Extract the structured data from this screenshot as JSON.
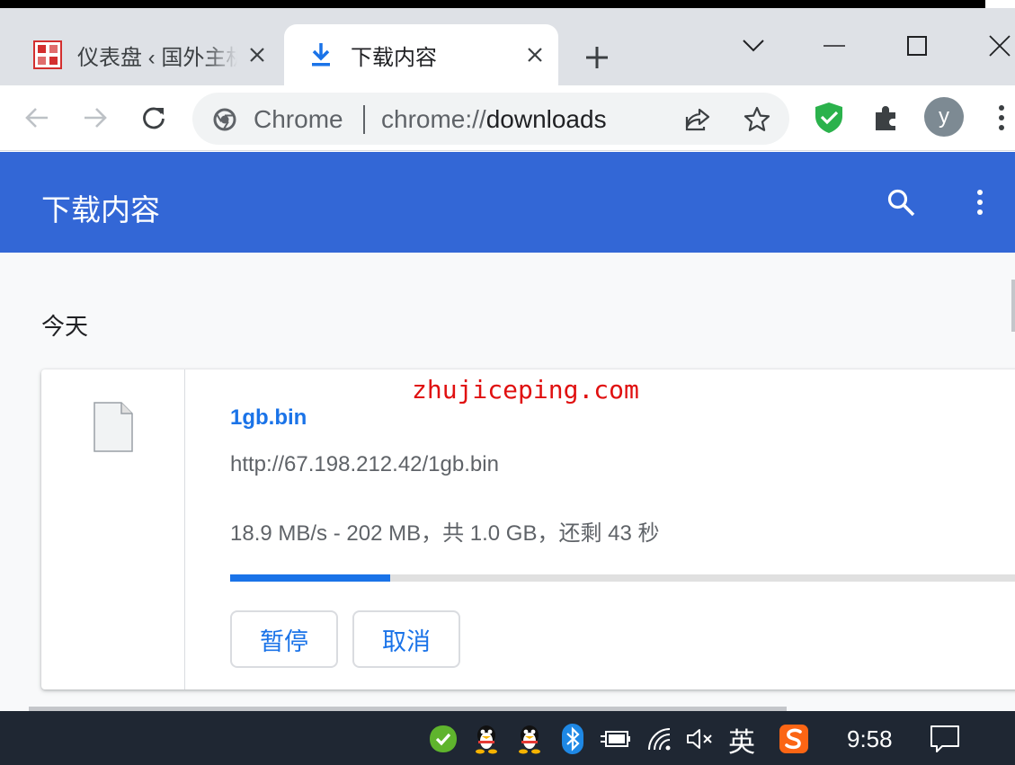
{
  "browser": {
    "tabs": [
      {
        "title": "仪表盘 ‹ 国外主机",
        "favicon": "site-logo-icon",
        "active": false
      },
      {
        "title": "下载内容",
        "favicon": "download-icon",
        "active": true
      }
    ],
    "omnibox": {
      "site_chip": "Chrome",
      "url_prefix": "chrome://",
      "url_host": "downloads"
    },
    "profile_initial": "y",
    "colors": {
      "tabstrip": "#dee1e6",
      "accent": "#1a73e8",
      "header": "#3367d6"
    }
  },
  "page": {
    "header_title": "下载内容",
    "date_group": "今天",
    "watermark": "zhujiceping.com",
    "download": {
      "file_name": "1gb.bin",
      "url": "http://67.198.212.42/1gb.bin",
      "status": "18.9 MB/s - 202 MB，共 1.0 GB，还剩 43 秒",
      "progress": 0.2,
      "pause_label": "暂停",
      "cancel_label": "取消"
    }
  },
  "taskbar": {
    "ime_label": "英",
    "clock": "9:58"
  }
}
